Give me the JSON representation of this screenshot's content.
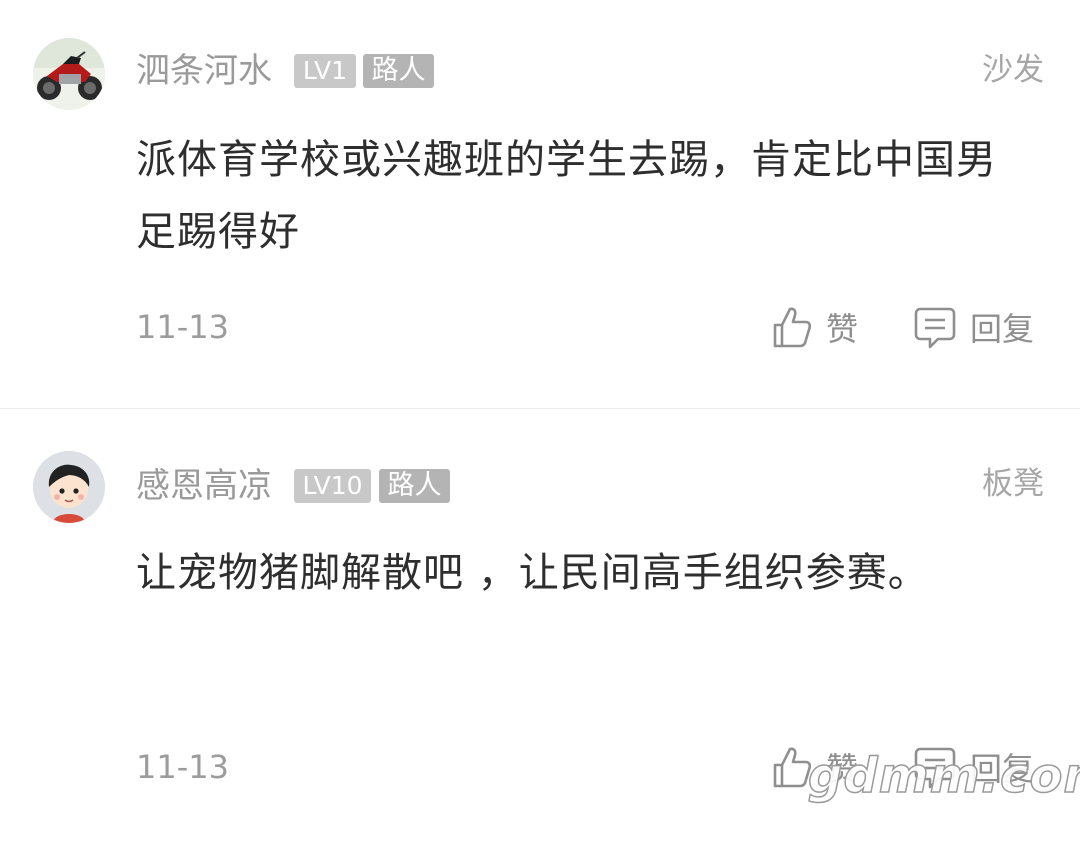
{
  "comments": [
    {
      "username": "泗条河水",
      "level": "LV1",
      "role": "路人",
      "floor": "沙发",
      "text": "派体育学校或兴趣班的学生去踢，肯定比中国男足踢得好",
      "date": "11-13",
      "like_label": "赞",
      "reply_label": "回复",
      "avatar": "motorcycle-avatar"
    },
    {
      "username": "感恩高凉",
      "level": "LV10",
      "role": "路人",
      "floor": "板凳",
      "text": "让宠物猪脚解散吧 ，让民间高手组织参赛。",
      "date": "11-13",
      "like_label": "赞",
      "reply_label": "回复",
      "avatar": "cartoon-boy-avatar"
    }
  ],
  "icons": {
    "like": "thumbs-up-icon",
    "reply": "comment-icon"
  },
  "watermark": "gdmm.com",
  "colors": {
    "username": "#9a9a9a",
    "content": "#2e2e2e",
    "badge": "#c8c8c8"
  }
}
